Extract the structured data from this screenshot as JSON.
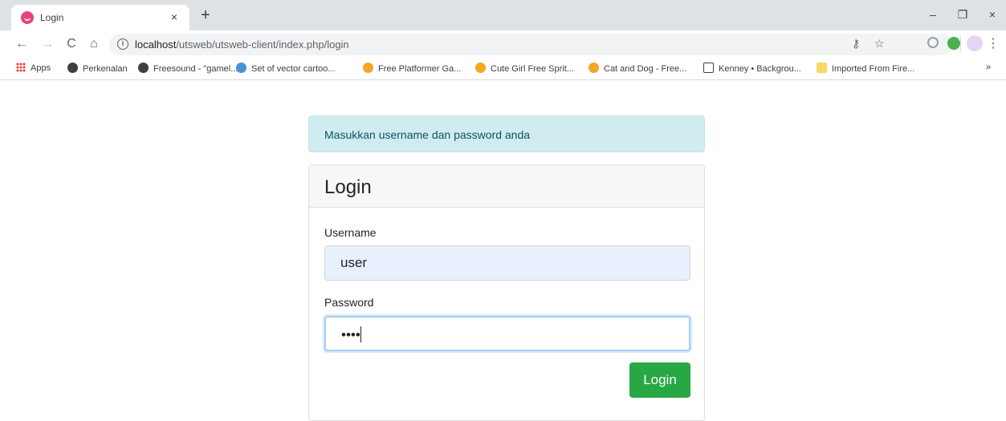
{
  "browser": {
    "tab_title": "Login",
    "tab_close": "×",
    "new_tab": "+",
    "window_controls": {
      "minimize": "–",
      "restore": "❐",
      "close": "×"
    },
    "nav": {
      "back": "←",
      "forward": "→",
      "reload": "C",
      "home": "⌂"
    },
    "url_host": "localhost",
    "url_path": "/utsweb/utsweb-client/index.php/login",
    "menu": "⋮",
    "overflow": "»",
    "bookmarks": [
      {
        "label": "Apps",
        "icon": "apps-grid-icon",
        "color": "#ea4335"
      },
      {
        "label": "Perkenalan",
        "icon": "globe-icon",
        "color": "#3c4043"
      },
      {
        "label": "Freesound - \"gamel...",
        "icon": "waveform-icon",
        "color": "#3c4043"
      },
      {
        "label": "Set of vector cartoo...",
        "icon": "cartoon-icon",
        "color": "#4a90d9"
      },
      {
        "label": "Free Platformer Ga...",
        "icon": "gamedev-icon",
        "color": "#f5a623"
      },
      {
        "label": "Cute Girl Free Sprit...",
        "icon": "gamedev-icon",
        "color": "#f5a623"
      },
      {
        "label": "Cat and Dog - Free...",
        "icon": "gamedev-icon",
        "color": "#f5a623"
      },
      {
        "label": "Kenney • Backgrou...",
        "icon": "kenney-icon",
        "color": "#3c4043"
      },
      {
        "label": "Imported From Fire...",
        "icon": "folder-icon",
        "color": "#fcd663"
      }
    ]
  },
  "page": {
    "alert_text": "Masukkan username dan password anda",
    "card_title": "Login",
    "username_label": "Username",
    "username_value": "user",
    "password_label": "Password",
    "password_value": "••••",
    "login_button": "Login"
  },
  "colors": {
    "alert_bg": "#d1ecf1",
    "alert_text": "#0c5460",
    "button": "#28a745",
    "autofill": "#e8f0fe"
  }
}
